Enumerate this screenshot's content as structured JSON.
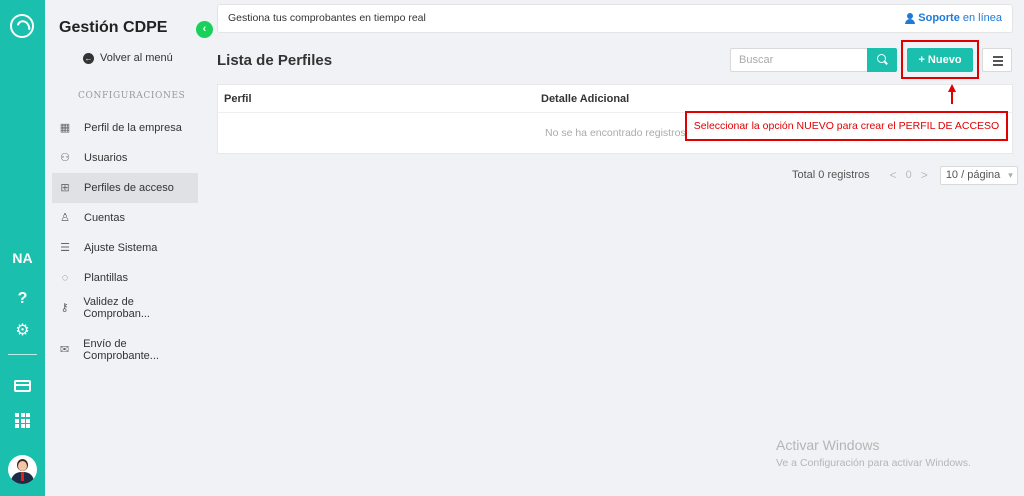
{
  "rail": {
    "user_initials": "NA",
    "help_label": "?",
    "icons": [
      "app-logo-icon",
      "help-icon",
      "gear-icon",
      "card-icon",
      "apps-grid-icon",
      "avatar"
    ]
  },
  "sidebar": {
    "title": "Gestión CDPE",
    "back_label": "Volver al menú",
    "section_label": "CONFIGURACIONES",
    "items": [
      {
        "label": "Perfil de la empresa",
        "icon": "building-icon"
      },
      {
        "label": "Usuarios",
        "icon": "users-icon"
      },
      {
        "label": "Perfiles de acceso",
        "icon": "sitemap-icon",
        "active": true
      },
      {
        "label": "Cuentas",
        "icon": "user-icon"
      },
      {
        "label": "Ajuste Sistema",
        "icon": "sliders-icon"
      },
      {
        "label": "Plantillas",
        "icon": "palette-icon"
      },
      {
        "label": "Validez de Comproban...",
        "icon": "key-icon"
      },
      {
        "label": "Envío de Comprobante...",
        "icon": "mail-icon"
      }
    ]
  },
  "topbar": {
    "text": "Gestiona tus comprobantes en tiempo real",
    "support_bold": "Soporte",
    "support_rest": "en línea"
  },
  "main": {
    "title": "Lista de Perfiles",
    "search_placeholder": "Buscar",
    "new_button": "+ Nuevo"
  },
  "table": {
    "columns": [
      "Perfil",
      "Detalle Adicional"
    ],
    "empty_text": "No se ha encontrado registros"
  },
  "annotation": {
    "text": "Seleccionar la opción NUEVO para crear el PERFIL DE ACCESO",
    "color": "#e00000"
  },
  "pagination": {
    "total": "Total 0 registros",
    "prev": "<",
    "current": "0",
    "next": ">",
    "page_size": "10 / página"
  },
  "watermark": {
    "title": "Activar Windows",
    "subtitle": "Ve a Configuración para activar Windows."
  },
  "colors": {
    "accent": "#1bbfae",
    "collapse": "#19d15a",
    "link": "#1e7ad8"
  }
}
